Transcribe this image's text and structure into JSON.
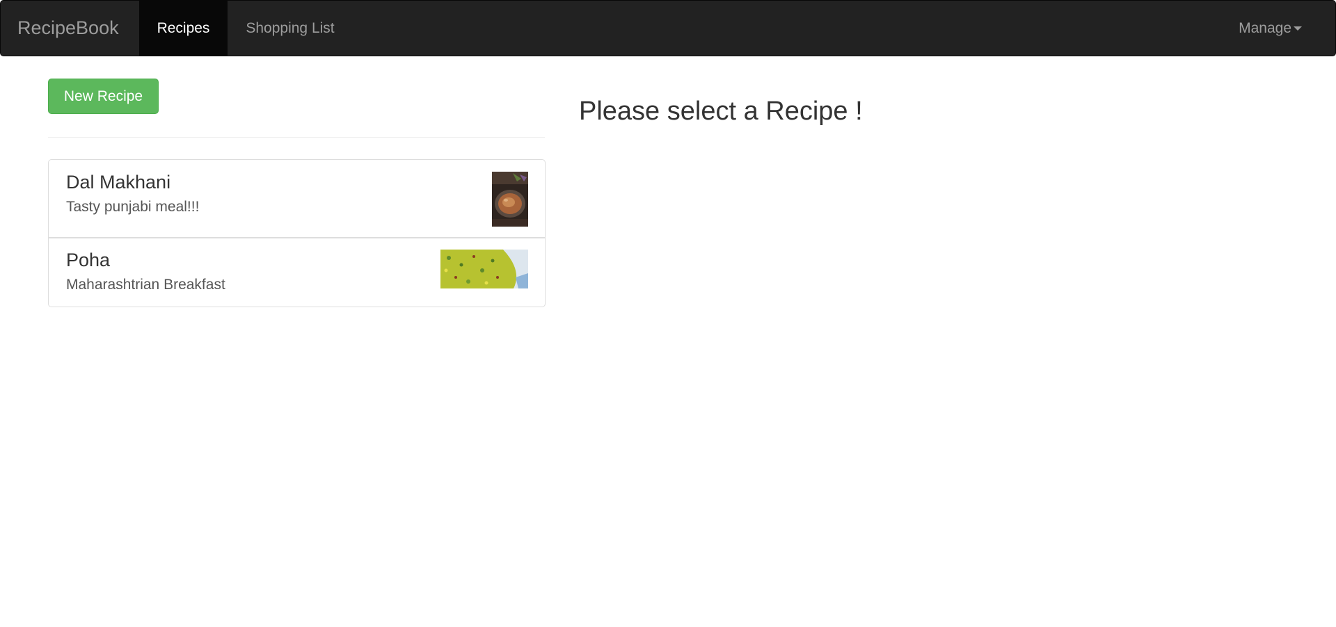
{
  "navbar": {
    "brand": "RecipeBook",
    "links": [
      {
        "label": "Recipes",
        "active": true
      },
      {
        "label": "Shopping List",
        "active": false
      }
    ],
    "manage_label": "Manage",
    "background": "#222222",
    "active_background": "#080808"
  },
  "sidebar": {
    "new_recipe_label": "New Recipe",
    "button_color": "#5cb85c",
    "recipes": [
      {
        "name": "Dal Makhani",
        "description": "Tasty punjabi meal!!!",
        "image_icon": "dal-makhani-photo"
      },
      {
        "name": "Poha",
        "description": "Maharashtrian Breakfast",
        "image_icon": "poha-photo"
      }
    ]
  },
  "main": {
    "placeholder": "Please select a Recipe !"
  }
}
